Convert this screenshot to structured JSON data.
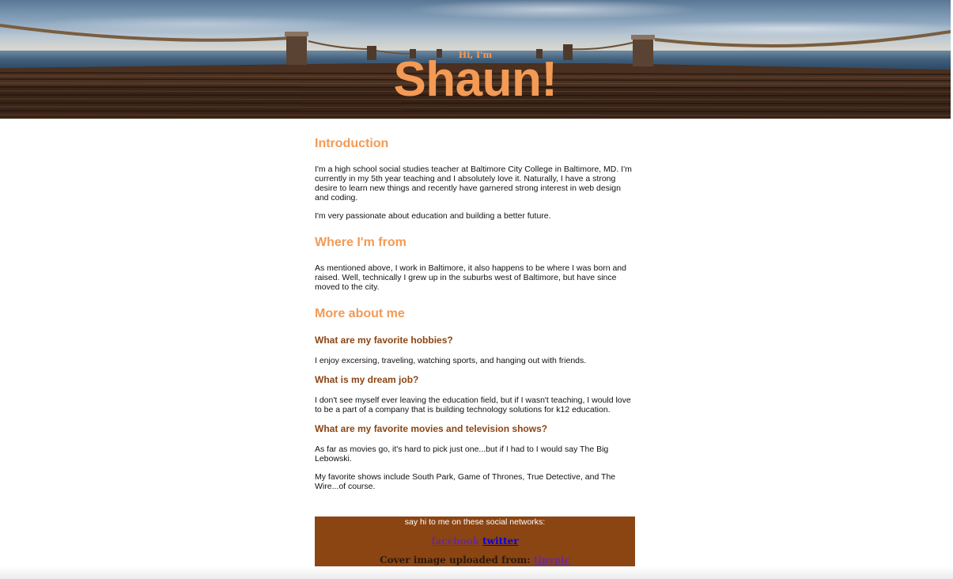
{
  "header": {
    "greeting": "Hi, I'm",
    "name": "Shaun!"
  },
  "sections": {
    "introduction": {
      "heading": "Introduction",
      "paragraphs": [
        "I'm a high school social studies teacher at Baltimore City College in Baltimore, MD. I'm currently in my 5th year teaching and I absolutely love it. Naturally, I have a strong desire to learn new things and recently have garnered strong interest in web design and coding.",
        "I'm very passionate about education and building a better future."
      ]
    },
    "where_from": {
      "heading": "Where I'm from",
      "paragraphs": [
        "As mentioned above, I work in Baltimore, it also happens to be where I was born and raised. Well, technically I grew up in the suburbs west of Baltimore, but have since moved to the city."
      ]
    },
    "more_about": {
      "heading": "More about me",
      "items": [
        {
          "question": "What are my favorite hobbies?",
          "answers": [
            "I enjoy excersing, traveling, watching sports, and hanging out with friends."
          ]
        },
        {
          "question": "What is my dream job?",
          "answers": [
            "I don't see myself ever leaving the education field, but if I wasn't teaching, I would love to be a part of a company that is building technology solutions for k12 education."
          ]
        },
        {
          "question": "What are my favorite movies and television shows?",
          "answers": [
            "As far as movies go, it's hard to pick just one...but if I had to I would say The Big Lebowski.",
            "My favorite shows include South Park, Game of Thrones, True Detective, and The Wire...of course."
          ]
        }
      ]
    }
  },
  "footer": {
    "social_text": "say hi to me on these social networks:",
    "links": {
      "facebook": "facebook",
      "twitter": "twitter"
    },
    "credit_text": "Cover image uploaded from:",
    "credit_link": "tinypic"
  },
  "colors": {
    "accent_orange": "#f39a55",
    "subheading_brown": "#8b4513",
    "footer_bg": "#8b4513",
    "visited_link": "#6b2a8c",
    "link_blue": "#0000ee"
  }
}
